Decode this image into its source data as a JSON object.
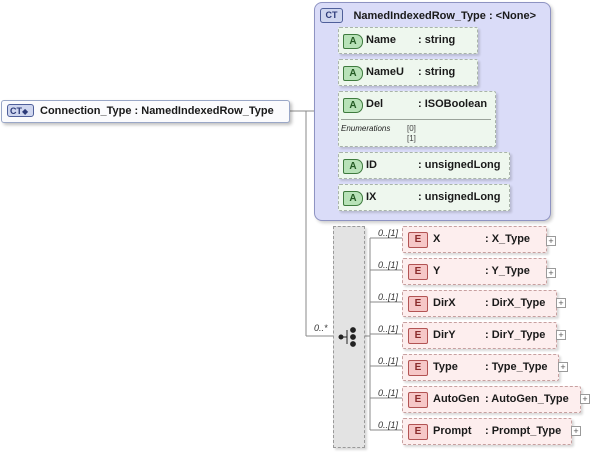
{
  "root": {
    "badge": "CT",
    "label": "Connection_Type : NamedIndexedRow_Type"
  },
  "type": {
    "badge": "CT",
    "label": "NamedIndexedRow_Type : <None>"
  },
  "attributes": [
    {
      "badge": "A",
      "name": "Name",
      "type": ": string"
    },
    {
      "badge": "A",
      "name": "NameU",
      "type": ": string"
    },
    {
      "badge": "A",
      "name": "Del",
      "type": ": ISOBoolean",
      "enum_label": "Enumerations",
      "enum_values": [
        "[0]",
        "[1]"
      ]
    },
    {
      "badge": "A",
      "name": "ID",
      "type": ": unsignedLong"
    },
    {
      "badge": "A",
      "name": "IX",
      "type": ": unsignedLong"
    }
  ],
  "sequence_occurrence": "0..*",
  "elements": [
    {
      "badge": "E",
      "occurrence": "0..[1]",
      "name": "X",
      "type": ": X_Type",
      "expand": "+"
    },
    {
      "badge": "E",
      "occurrence": "0..[1]",
      "name": "Y",
      "type": ": Y_Type",
      "expand": "+"
    },
    {
      "badge": "E",
      "occurrence": "0..[1]",
      "name": "DirX",
      "type": ": DirX_Type",
      "expand": "+"
    },
    {
      "badge": "E",
      "occurrence": "0..[1]",
      "name": "DirY",
      "type": ": DirY_Type",
      "expand": "+"
    },
    {
      "badge": "E",
      "occurrence": "0..[1]",
      "name": "Type",
      "type": ": Type_Type",
      "expand": "+"
    },
    {
      "badge": "E",
      "occurrence": "0..[1]",
      "name": "AutoGen",
      "type": ": AutoGen_Type",
      "expand": "+"
    },
    {
      "badge": "E",
      "occurrence": "0..[1]",
      "name": "Prompt",
      "type": ": Prompt_Type",
      "expand": "+"
    }
  ]
}
